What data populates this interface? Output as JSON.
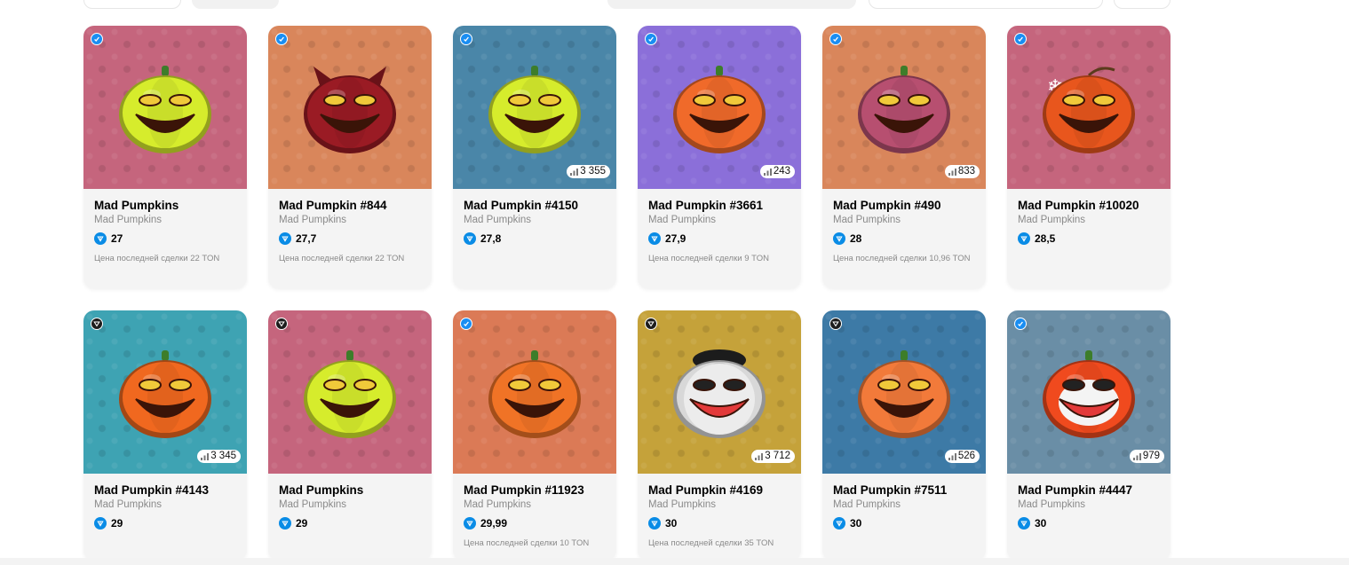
{
  "cards": [
    {
      "title": "Mad Pumpkins",
      "collection": "Mad Pumpkins",
      "price": "27",
      "last_sale": "Цена последней сделки 22 TON",
      "stat": "",
      "badge": "blue",
      "bg": "#c5657d",
      "pumpkin": "#d6ec2c",
      "horns": false,
      "hat": false,
      "clown": false,
      "bomb": false
    },
    {
      "title": "Mad Pumpkin #844",
      "collection": "Mad Pumpkins",
      "price": "27,7",
      "last_sale": "Цена последней сделки 22 TON",
      "stat": "",
      "badge": "blue",
      "bg": "#d9865b",
      "pumpkin": "#9a1b24",
      "horns": true,
      "hat": false,
      "clown": false,
      "bomb": false
    },
    {
      "title": "Mad Pumpkin #4150",
      "collection": "Mad Pumpkins",
      "price": "27,8",
      "last_sale": "",
      "stat": "3 355",
      "badge": "blue",
      "bg": "#4a86a8",
      "pumpkin": "#d6ec2c",
      "horns": false,
      "hat": false,
      "clown": false,
      "bomb": false
    },
    {
      "title": "Mad Pumpkin #3661",
      "collection": "Mad Pumpkins",
      "price": "27,9",
      "last_sale": "Цена последней сделки 9 TON",
      "stat": "243",
      "badge": "blue",
      "bg": "#8b6fd9",
      "pumpkin": "#f06a2a",
      "horns": false,
      "hat": false,
      "clown": false,
      "bomb": false
    },
    {
      "title": "Mad Pumpkin #490",
      "collection": "Mad Pumpkins",
      "price": "28",
      "last_sale": "Цена последней сделки 10,96 TON",
      "stat": "833",
      "badge": "blue",
      "bg": "#d9865b",
      "pumpkin": "#b74f70",
      "horns": false,
      "hat": false,
      "clown": false,
      "bomb": false
    },
    {
      "title": "Mad Pumpkin #10020",
      "collection": "Mad Pumpkins",
      "price": "28,5",
      "last_sale": "",
      "stat": "",
      "badge": "blue",
      "bg": "#c5657d",
      "pumpkin": "#e8561d",
      "horns": false,
      "hat": false,
      "clown": false,
      "bomb": true
    },
    {
      "title": "Mad Pumpkin #4143",
      "collection": "Mad Pumpkins",
      "price": "29",
      "last_sale": "",
      "stat": "3 345",
      "badge": "dark",
      "bg": "#3ea3b3",
      "pumpkin": "#f0681f",
      "horns": false,
      "hat": false,
      "clown": false,
      "bomb": false
    },
    {
      "title": "Mad Pumpkins",
      "collection": "Mad Pumpkins",
      "price": "29",
      "last_sale": "",
      "stat": "",
      "badge": "dark",
      "bg": "#c5657d",
      "pumpkin": "#d6ec2c",
      "horns": false,
      "hat": false,
      "clown": false,
      "bomb": false
    },
    {
      "title": "Mad Pumpkin #11923",
      "collection": "Mad Pumpkins",
      "price": "29,99",
      "last_sale": "Цена последней сделки 10 TON",
      "stat": "",
      "badge": "blue",
      "bg": "#db7a56",
      "pumpkin": "#f07326",
      "horns": false,
      "hat": false,
      "clown": false,
      "bomb": false
    },
    {
      "title": "Mad Pumpkin #4169",
      "collection": "Mad Pumpkins",
      "price": "30",
      "last_sale": "Цена последней сделки 35 TON",
      "stat": "3 712",
      "badge": "dark",
      "bg": "#c5a23a",
      "pumpkin": "#d8d8d8",
      "horns": false,
      "hat": true,
      "clown": false,
      "bomb": false
    },
    {
      "title": "Mad Pumpkin #7511",
      "collection": "Mad Pumpkins",
      "price": "30",
      "last_sale": "",
      "stat": "526",
      "badge": "dark",
      "bg": "#3d7aa6",
      "pumpkin": "#f27a3a",
      "horns": false,
      "hat": false,
      "clown": false,
      "bomb": false
    },
    {
      "title": "Mad Pumpkin #4447",
      "collection": "Mad Pumpkins",
      "price": "30",
      "last_sale": "",
      "stat": "979",
      "badge": "blue",
      "bg": "#6a8ea6",
      "pumpkin": "#f04a1e",
      "horns": false,
      "hat": false,
      "clown": true,
      "bomb": false
    }
  ]
}
